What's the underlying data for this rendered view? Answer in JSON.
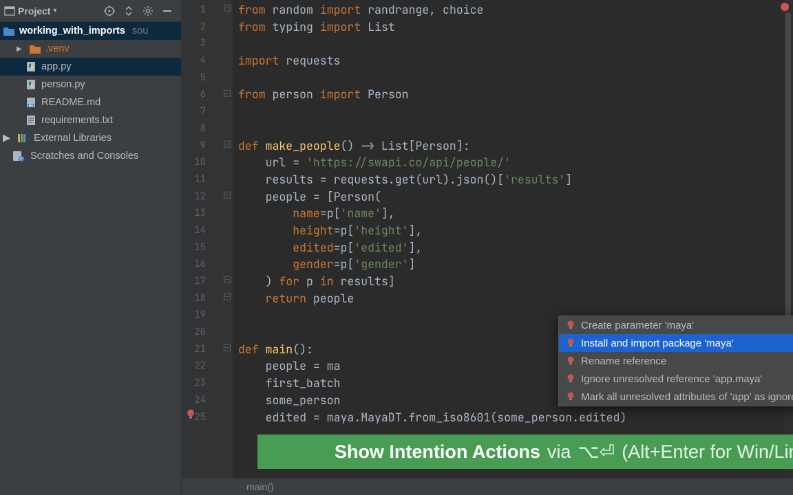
{
  "sidebar": {
    "title": "Project",
    "root_name": "working_with_imports",
    "root_extra": "sou",
    "items": [
      {
        "label": ".venv",
        "type": "folder",
        "cls": "venv"
      },
      {
        "label": "app.py",
        "type": "python",
        "selected": true
      },
      {
        "label": "person.py",
        "type": "python"
      },
      {
        "label": "README.md",
        "type": "md"
      },
      {
        "label": "requirements.txt",
        "type": "txt"
      }
    ],
    "external_label": "External Libraries",
    "scratches_label": "Scratches and Consoles"
  },
  "code": {
    "lines": [
      {
        "n": 1,
        "fold": "box",
        "html": "<span class='kw'>from</span> <span class='plain'>random</span> <span class='kw'>import</span> <span class='plain'>randrange, choice</span>"
      },
      {
        "n": 2,
        "html": "<span class='kw'>from</span> <span class='plain'>typing</span> <span class='kw'>import</span> <span class='plain'>List</span>"
      },
      {
        "n": 3,
        "html": ""
      },
      {
        "n": 4,
        "html": "<span class='kw'>import</span> <span class='plain'>requests</span>"
      },
      {
        "n": 5,
        "html": ""
      },
      {
        "n": 6,
        "fold": "box",
        "html": "<span class='kw'>from</span> <span class='plain'>person</span> <span class='kw'>import</span> <span class='plain'>Person</span>"
      },
      {
        "n": 7,
        "html": ""
      },
      {
        "n": 8,
        "html": ""
      },
      {
        "n": 9,
        "fold": "box",
        "html": "<span class='kw'>def</span> <span class='fn'>make_people</span><span class='plain'>() -&gt; List[Person]:</span>"
      },
      {
        "n": 10,
        "html": "    <span class='plain'>url = </span><span class='str'>'https://swapi.co/api/people/'</span>"
      },
      {
        "n": 11,
        "html": "    <span class='plain'>results = requests.get(url).json()[</span><span class='str'>'results'</span><span class='plain'>]</span>"
      },
      {
        "n": 12,
        "fold": "box",
        "html": "    <span class='plain'>people = [Person(</span>"
      },
      {
        "n": 13,
        "html": "        <span class='param'>name</span><span class='plain'>=p[</span><span class='str'>'name'</span><span class='plain'>],</span>"
      },
      {
        "n": 14,
        "html": "        <span class='param'>height</span><span class='plain'>=p[</span><span class='str'>'height'</span><span class='plain'>],</span>"
      },
      {
        "n": 15,
        "html": "        <span class='param'>edited</span><span class='plain'>=p[</span><span class='str'>'edited'</span><span class='plain'>],</span>"
      },
      {
        "n": 16,
        "html": "        <span class='param'>gender</span><span class='plain'>=p[</span><span class='str'>'gender'</span><span class='plain'>]</span>"
      },
      {
        "n": 17,
        "fold": "box",
        "html": "    <span class='plain'>) </span><span class='kw'>for</span><span class='plain'> p </span><span class='kw'>in</span><span class='plain'> results]</span>"
      },
      {
        "n": 18,
        "fold": "box",
        "html": "    <span class='kw'>return</span><span class='plain'> people</span>"
      },
      {
        "n": 19,
        "html": ""
      },
      {
        "n": 20,
        "html": ""
      },
      {
        "n": 21,
        "fold": "box",
        "html": "<span class='kw'>def</span> <span class='fn'>main</span><span class='plain'>():</span>"
      },
      {
        "n": 22,
        "html": "    <span class='plain'>people = ma</span>"
      },
      {
        "n": 23,
        "html": "    <span class='plain'>first_batch</span>"
      },
      {
        "n": 24,
        "html": "    <span class='plain'>some_person</span>"
      },
      {
        "n": 25,
        "bulb": true,
        "html": "    <span class='plain'>edited = maya.MayaDT.from_iso8601(some_person.edited)</span>"
      }
    ]
  },
  "intentions": {
    "items": [
      {
        "label": "Create parameter 'maya'",
        "arrow": true
      },
      {
        "label": "Install and import package 'maya'",
        "arrow": true,
        "selected": true
      },
      {
        "label": "Rename reference",
        "arrow": true
      },
      {
        "label": "Ignore unresolved reference 'app.maya'",
        "arrow": true
      },
      {
        "label": "Mark all unresolved attributes of 'app' as ignored",
        "arrow": true
      }
    ]
  },
  "tip": {
    "strong": "Show Intention Actions",
    "via": "via",
    "shortcut_mac": "⌥⏎",
    "rest": "(Alt+Enter for Win/Linux)"
  },
  "breadcrumb": "main()"
}
